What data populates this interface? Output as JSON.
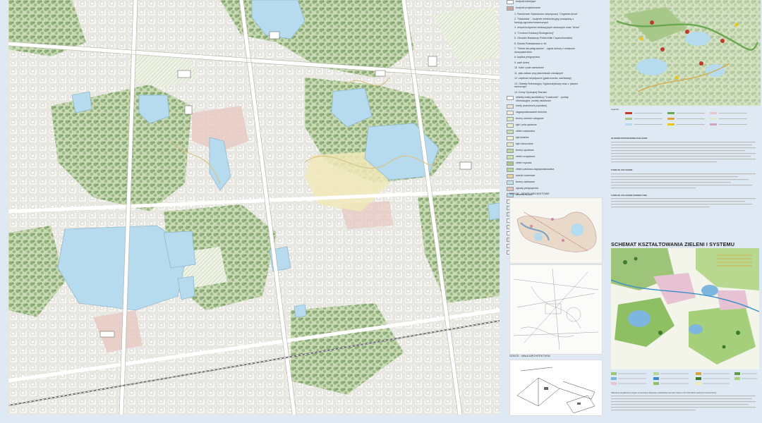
{
  "legend": {
    "items": [
      {
        "label": "budynki istniejące",
        "color": "#ffffff"
      },
      {
        "label": "budynki projektowane",
        "color": "#c9a99a"
      },
      {
        "label": "1. Pawilonwer Wystawowo-Artystyczny \"Cegielnia Anna\"",
        "color": ""
      },
      {
        "label": "2. \"Sadzanka\" - budynek wielofunkcyjny powiązany z funkcją ogrodów botanicznych",
        "color": ""
      },
      {
        "label": "3. zespół budynków edukacyjnych stokowych wraz \"Anna\"",
        "color": ""
      },
      {
        "label": "4. \"Centrum Edukacji Ekologicznej\"",
        "color": ""
      },
      {
        "label": "5. Ośrodek Badawczy Politechniki Częstochowskiej",
        "color": ""
      },
      {
        "label": "6. Szkoła Podstawowa nr 46",
        "color": ""
      },
      {
        "label": "7. \"Strefa dla pielgrzymów\" - ogród dobory z miejscem duszpasterskim",
        "color": ""
      },
      {
        "label": "8. kaplica pielgrzymów",
        "color": ""
      },
      {
        "label": "9. park dzieci",
        "color": ""
      },
      {
        "label": "10. hotel i pole namiotowe",
        "color": ""
      },
      {
        "label": "11. plac zabaw przy placówkach wiodących",
        "color": ""
      },
      {
        "label": "12. zaplecze turystyczne (gastronomia, sanitariaty)",
        "color": ""
      },
      {
        "label": "13. Obiekty Rekreacyjny Ogólnoużytkowy wraz z placem tanecznym",
        "color": ""
      },
      {
        "label": "14. Domy Spokojnej Starości",
        "color": ""
      },
      {
        "label": "obiekty małej architektury \"Łuszkowie\" - punkty informacyjne, punkty widokowe",
        "color": "#ffffff"
      },
      {
        "label": "strefy przestrzeni prywatnej",
        "color": "#e9e4d7"
      },
      {
        "label": "zagospodarowanie terenów",
        "color": "#f2eadb"
      },
      {
        "label": "tereny rolnicze usługowe",
        "color": "#d9e6c2"
      },
      {
        "label": "łąki i pola uprawne",
        "color": "#e8f0d0"
      },
      {
        "label": "zieleń nadwodna",
        "color": "#c8ddb3"
      },
      {
        "label": "łąki kwietne",
        "color": "#eef3d7"
      },
      {
        "label": "łąki różnorodne",
        "color": "#dfe9c5"
      },
      {
        "label": "tereny sportowe",
        "color": "#bcd59c"
      },
      {
        "label": "zieleń urządzona",
        "color": "#cde3ae"
      },
      {
        "label": "zieleń wysoka",
        "color": "#a8c88a"
      },
      {
        "label": "zieleń parkowa zagospodarowana",
        "color": "#b8d59a"
      },
      {
        "label": "ścieżki rowerowe",
        "color": "#e5d3a1"
      },
      {
        "label": "tereny zalewowe",
        "color": "#c6e0ee"
      },
      {
        "label": "ogrody pielgrzymów",
        "color": "#e4c6c0"
      },
      {
        "label": "zbiornik wodne",
        "color": "#b9dcef"
      },
      {
        "label": "pola uprawne",
        "color": "#f3f0de"
      },
      {
        "label": "plac wodny",
        "color": "#d6e9f5"
      },
      {
        "label": "parkingi",
        "color": "#e0e0e0"
      },
      {
        "label": "ścieżki mieszkaniowe",
        "color": "#f5f5f5"
      },
      {
        "label": "przestrzeń ogólnodostępna",
        "color": "#efe7c9"
      },
      {
        "label": "ciągi piesze",
        "color": "#ffffff"
      },
      {
        "label": "ciągi jezdne",
        "color": "#dddddd"
      },
      {
        "label": "pomniki",
        "color": "#f0f0f0"
      },
      {
        "label": "ławki",
        "color": "#f0f0f0"
      }
    ]
  },
  "sketch_titles": {
    "sketch1": "SZKICE - ETAPY PROJEKTOWE",
    "sketch2": "SZKICE - MAŁA ARCHITEKTURA"
  },
  "right": {
    "section_title": "SCHEMAT KSZTAŁTOWANIA ZIELENI I SYSTEMU WODNEGO",
    "legend_label": "Legenda",
    "text_heading_1": "GŁÓWNE PRZESTRZENIE PUBLICZNE",
    "text_heading_2": "FUNKCJE USŁUGOWE",
    "text_heading_3": "FUNKCJE USŁUGOWE KOMERCYJNE",
    "footer_text": "Założenia projektowe przyjęte w koncepcji obejmują rewitalizację terenów zieleni oraz zbiorników wodnych Częstochowy"
  }
}
